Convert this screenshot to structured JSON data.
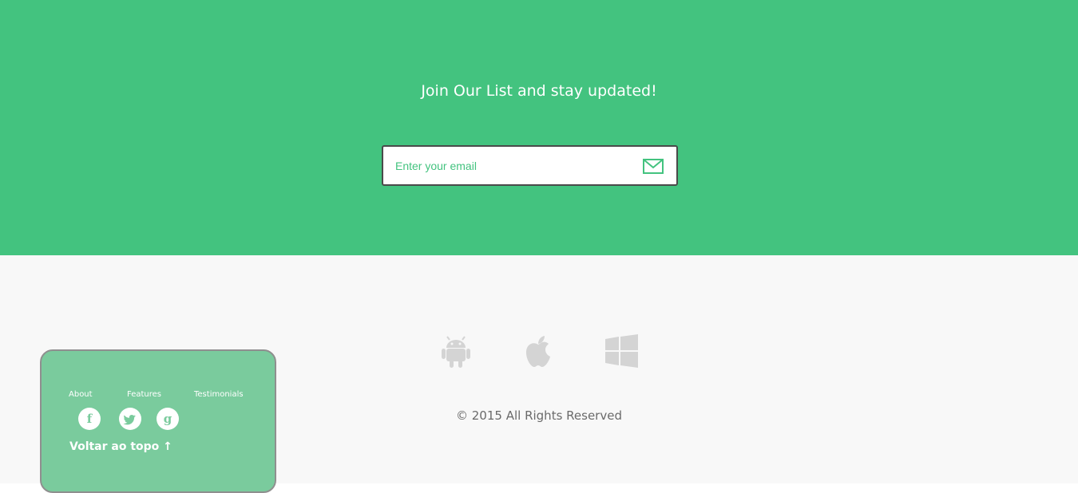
{
  "newsletter": {
    "title": "Join Our List and stay updated!",
    "email_placeholder": "Enter your email",
    "email_value": "",
    "send_icon": "envelope-icon",
    "accent_color": "#43c37f"
  },
  "footer": {
    "platforms": [
      "android-icon",
      "apple-icon",
      "windows-icon"
    ],
    "copyright": "© 2015 All Rights Reserved"
  },
  "panel": {
    "links": [
      "About",
      "Features",
      "Testimonials"
    ],
    "social": [
      {
        "icon": "facebook-icon",
        "glyph": "f"
      },
      {
        "icon": "twitter-icon",
        "glyph": "t"
      },
      {
        "icon": "google-icon",
        "glyph": "g"
      }
    ],
    "back_to_top": "Voltar ao topo ↑"
  }
}
